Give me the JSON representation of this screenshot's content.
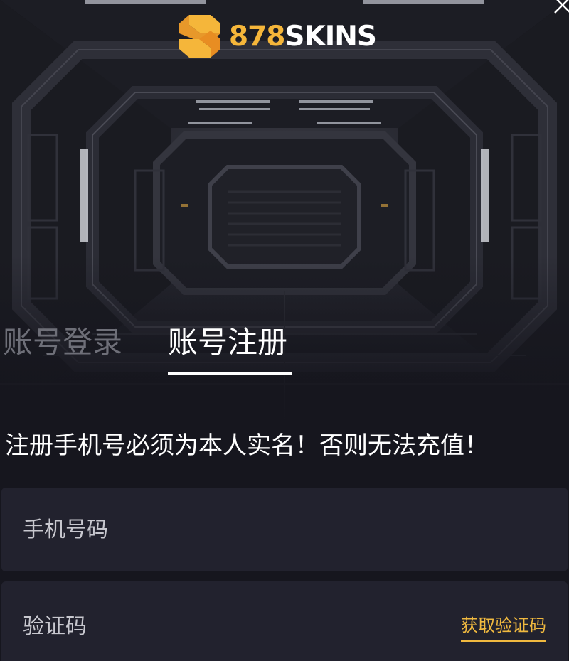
{
  "brand": {
    "number": "878",
    "word": "SKINS",
    "accent_color": "#f5b63a"
  },
  "icons": {
    "logo": "brand-logo-icon",
    "close": "close-icon"
  },
  "tabs": [
    {
      "label": "账号登录",
      "active": false
    },
    {
      "label": "账号注册",
      "active": true
    }
  ],
  "notice": "注册手机号必须为本人实名！否则无法充值！",
  "form": {
    "phone": {
      "placeholder": "手机号码",
      "value": ""
    },
    "code": {
      "placeholder": "验证码",
      "value": ""
    },
    "get_code_label": "获取验证码"
  },
  "colors": {
    "background": "#16161e",
    "input_bg": "#22222e",
    "inactive_tab": "#6e6f78",
    "link": "#f0b93f"
  }
}
